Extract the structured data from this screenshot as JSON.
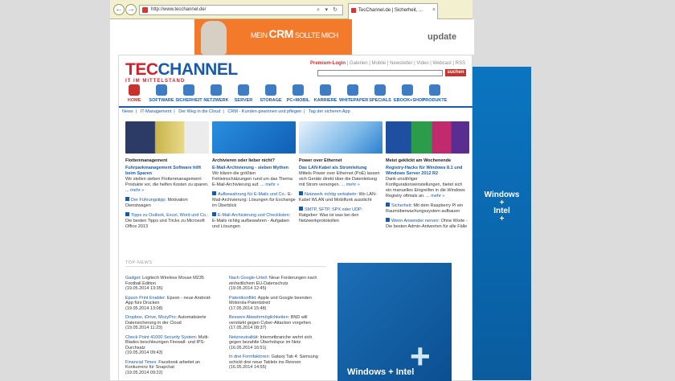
{
  "browser": {
    "url": "http://www.tecchannel.de/",
    "tab_title": "TecChannel.de | Sicherheit, ...",
    "back": "←",
    "forward": "→",
    "search_icon": "⌕",
    "dropdown_icon": "▾",
    "refresh": "↻",
    "tab_close": "×"
  },
  "top_ad": {
    "main": "CRM",
    "prefix": "MEIN ",
    "suffix": " SOLLTE MICH",
    "brand": "update"
  },
  "site": {
    "logo": "TECCHANNEL",
    "logo_tec": "TEC",
    "logo_channel": "CHANNEL",
    "subtitle": "IT IM MITTELSTAND",
    "premium_login": "Premium-Login",
    "links": [
      "Galerien",
      "Mobile",
      "Newsletter",
      "Video",
      "Webcast",
      "RSS"
    ],
    "search_button": "suchen",
    "nav": [
      "HOME",
      "SOFTWARE",
      "SICHERHEIT",
      "NETZWERK",
      "SERVER",
      "STORAGE",
      "PC+MOBIL",
      "KARRIERE",
      "WHITEPAPER",
      "SPECIALS",
      "EBOOK+SHOP",
      "PRODUKTE"
    ],
    "subnav": [
      "News",
      "|",
      "IT-Management",
      "|",
      "Der Weg in die Cloud",
      "|",
      "CRM - Kunden gewinnen und pflegen",
      "|",
      "Tag der sicheren App"
    ]
  },
  "features": [
    {
      "category": "Flottenmanagement",
      "headline": "Fuhrparkmanagement Software hilft beim Sparen",
      "text": "Wir stellen sieben Flottenmanagement-Produkte vor, die helfen Kosten zu sparen. ...",
      "more": "mehr »",
      "subs": [
        {
          "link": "Der Führungstipp:",
          "text": "Motivation Dienstwagen"
        },
        {
          "link": "Tipps zu Outlook, Excel, Word und Co.:",
          "text": "Die besten Tipps und Tricks zu Microsoft Office 2013"
        }
      ]
    },
    {
      "category": "Archivieren oder lieber nicht?",
      "headline": "E-Mail-Archivierung - sieben Mythen",
      "text": "Wir klären die größten Fehleinschätzungen rund um das Thema E-Mail-Archivierung auf. ...",
      "more": "mehr »",
      "subs": [
        {
          "link": "Aufbewahrung für E-Mails und Co.:",
          "text": "E-Mail-Archivierung: Lösungen für Exchange im Überblick"
        },
        {
          "link": "E-Mail-Archivierung und Checklisten:",
          "text": "E-Mails richtig aufbewahren - Aufgaben und Lösungen"
        }
      ]
    },
    {
      "category": "Power over Ethernet",
      "headline": "Das LAN-Kabel als Stromleitung",
      "text": "Mittels Power over Ethernet (PoE) lassen sich Geräte direkt über die Datenleitung mit Strom versorgen. ...",
      "more": "mehr »",
      "subs": [
        {
          "link": "Netzwerk richtig verkabeln:",
          "text": "Wo LAN-Kabel WLAN und Mobilfunk aussticht"
        },
        {
          "link": "SMTP, SFTP, SPX oder UDP:",
          "text": "Ratgeber: Was ist was bei den Netzwerkprotokollen"
        }
      ]
    },
    {
      "category": "Meist geklickt am Wochenende",
      "headline": "Registry-Hacks für Windows 8.1 und Windows Server 2012 R2",
      "text": "Dank unzähliger Konfigurationseinstellungen, bietet sich ein manuelles Eingreifen in die Windows Registry oftmals an. ...",
      "more": "mehr »",
      "subs": [
        {
          "link": "Sicherheit:",
          "text": "Mit dem Raspberry Pi ein Raumüberwachungssystem aufbauen"
        },
        {
          "link": "Wenn Anwender nerven:",
          "text": "Ohne Worte - Die besten Admin-Antworten für alle Fälle"
        }
      ]
    }
  ],
  "top_news_title": "TOP-NEWS",
  "news_left": [
    {
      "link": "Gadget:",
      "text": "Logitech Wireless Mouse M235 Football Edition",
      "date": "(19.05.2014 13:35)"
    },
    {
      "link": "Epson Print Enabler:",
      "text": "Epson - neue Android-App fürs Drucken",
      "date": "(19.05.2014 13:08)"
    },
    {
      "link": "Dropbox, iDrive, MozyPro:",
      "text": "Automatisierte Datensicherung in der Cloud",
      "date": "(19.05.2014 11:23)"
    },
    {
      "link": "Check Point 41000 Security System:",
      "text": "Multi-Blades beschleunigen Firewall- und IPS-Durchsatz",
      "date": "(19.05.2014 09:43)"
    },
    {
      "link": "Financial Times:",
      "text": "Facebook arbeitet an Konkurrenz für Snapchat",
      "date": "(19.05.2014 09:22)"
    }
  ],
  "news_right": [
    {
      "link": "Nach Google-Urteil:",
      "text": "Neue Forderungen nach einheitlichem EU-Datenschutz",
      "date": "(19.05.2014 12:45)"
    },
    {
      "link": "Patentkonflikt:",
      "text": "Apple und Google beenden Motorola-Patentstreit",
      "date": "(17.05.2014 15:48)"
    },
    {
      "link": "Bessere Abwehrmöglichkeiten:",
      "text": "BND will verstärkt gegen Cyber-Attacken vorgehen",
      "date": "(17.05.2014 08:37)"
    },
    {
      "link": "Netzneutralität:",
      "text": "Internetbranche wehrt sich gegen bezahlte Überholspur im Netz",
      "date": "(16.05.2014 16:51)"
    },
    {
      "link": "In drei Formfaktoren:",
      "text": "Galaxy Tab 4: Samsung schickt drei neue Tablets ins Rennen",
      "date": "(16.05.2014 14:55)"
    }
  ],
  "side_ad": {
    "line1": "Windows",
    "line2": "+",
    "line3": "Intel",
    "line4": "+"
  },
  "middle_ad": {
    "text": "Windows + Intel",
    "mark": "+"
  }
}
